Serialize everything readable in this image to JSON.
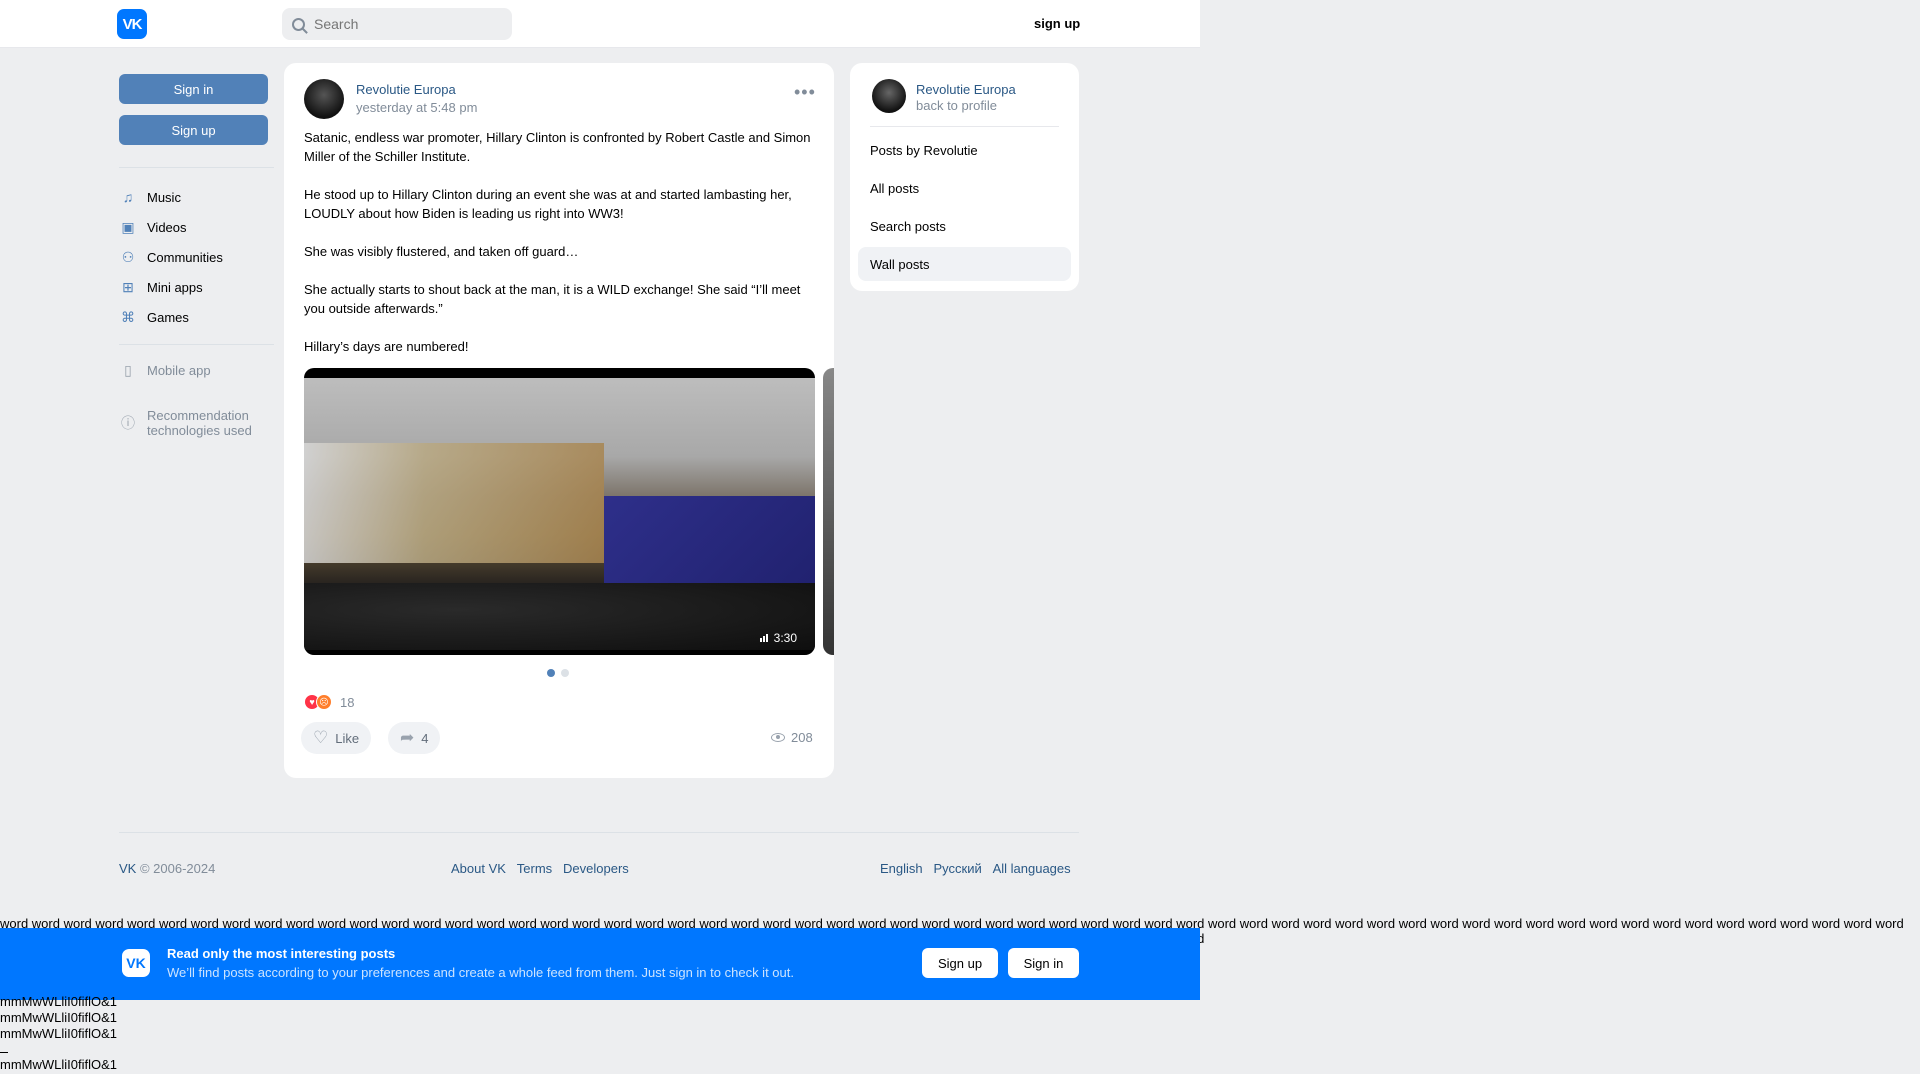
{
  "header": {
    "logo": "VK",
    "search_placeholder": "Search",
    "signup": "sign up"
  },
  "sidebar": {
    "sign_in": "Sign in",
    "sign_up": "Sign up",
    "items": [
      {
        "label": "Music",
        "icon": "music-icon"
      },
      {
        "label": "Videos",
        "icon": "video-icon"
      },
      {
        "label": "Communities",
        "icon": "users-icon"
      },
      {
        "label": "Mini apps",
        "icon": "grid-icon"
      },
      {
        "label": "Games",
        "icon": "gamepad-icon"
      }
    ],
    "mobile_app": "Mobile app",
    "recommendation_1": "Recommendation",
    "recommendation_2": "technologies used"
  },
  "post": {
    "author": "Revolutie Europa",
    "time": "yesterday at 5:48 pm",
    "paragraphs": [
      "Satanic, endless war promoter, Hillary Clinton is confronted by Robert Castle and Simon Miller of the Schiller Institute.",
      "He stood up to Hillary Clinton during an event she was at and started lambasting her, LOUDLY about how Biden is leading us right into WW3!",
      "She was visibly flustered, and taken off guard…",
      "She actually starts to shout back at the man, it is a WILD exchange! She said “I’ll meet you outside afterwards.”",
      "Hillary’s days are numbered!"
    ],
    "video_duration": "3:30",
    "reaction_count": "18",
    "like_label": "Like",
    "share_count": "4",
    "views": "208"
  },
  "right_panel": {
    "name": "Revolutie Europa",
    "back": "back to profile",
    "links": [
      "Posts by Revolutie",
      "All posts",
      "Search posts",
      "Wall posts"
    ]
  },
  "footer": {
    "vk": "VK",
    "copyright": " © 2006-2024",
    "about": "About VK",
    "terms": "Terms",
    "developers": "Developers",
    "english": "English",
    "russian": "Русский",
    "all_languages": "All languages"
  },
  "words_text": "word word word word word word word word word word word word word word word word word word word word word word word word word word word word word word word word word word word word word word word word word word word word word word word word word word word word word word word word word word word word word word word word word word word word word word word word word word word word word word word word word word word word word word word word word word word word word word word word word word",
  "banner": {
    "logo": "VK",
    "title": "Read only the most interesting posts",
    "subtitle": "We’ll find posts according to your preferences and create a whole feed from them. Just sign in to check it out.",
    "sign_up": "Sign up",
    "sign_in": "Sign in"
  },
  "test_line": "mmMwWLliI0fiflO&1",
  "colors": {
    "accent": "#0077ff",
    "button": "#5181b8",
    "link": "#2a5885",
    "background": "#edeef0"
  }
}
